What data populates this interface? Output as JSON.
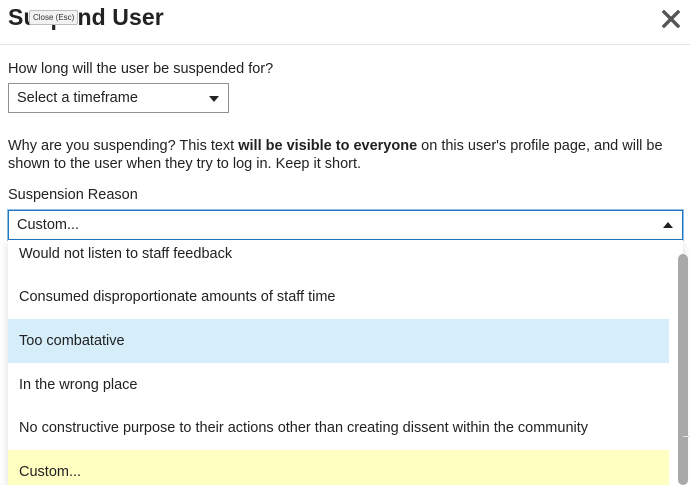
{
  "modal": {
    "title": "Suspend User",
    "close_tooltip": "Close (Esc)"
  },
  "duration": {
    "question": "How long will the user be suspended for?",
    "selected": "Select a timeframe"
  },
  "reason": {
    "description_before": "Why are you suspending? This text ",
    "description_bold": "will be visible to everyone",
    "description_after": " on this user's profile page, and will be shown to the user when they try to log in. Keep it short.",
    "label": "Suspension Reason",
    "selected": "Custom...",
    "options": [
      "Would not listen to staff feedback",
      "Consumed disproportionate amounts of staff time",
      "Too combatative",
      "In the wrong place",
      "No constructive purpose to their actions other than creating dissent within the community",
      "Custom..."
    ]
  },
  "colors": {
    "hover_option": "#d6edfa",
    "selected_option": "#ffffc2",
    "focus_border": "#1f76c2"
  }
}
